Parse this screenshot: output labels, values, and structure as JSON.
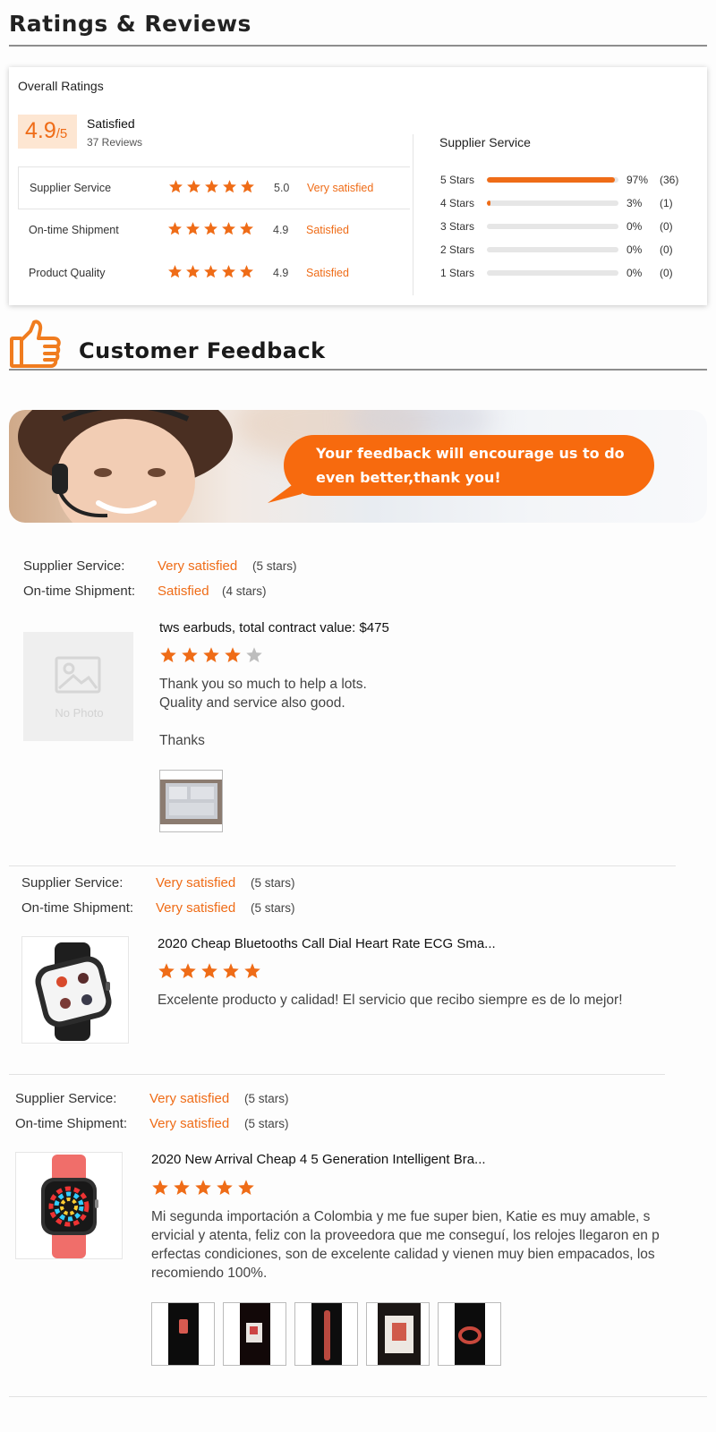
{
  "header": {
    "title": "Ratings & Reviews"
  },
  "overall": {
    "title": "Overall Ratings",
    "score": "4.9",
    "score_den": "/5",
    "label": "Satisfied",
    "reviews": "37 Reviews",
    "metrics": [
      {
        "name": "Supplier Service",
        "value": "5.0",
        "rating": 5.0,
        "text": "Very satisfied"
      },
      {
        "name": "On-time Shipment",
        "value": "4.9",
        "rating": 4.9,
        "text": "Satisfied"
      },
      {
        "name": "Product Quality",
        "value": "4.9",
        "rating": 4.9,
        "text": "Satisfied"
      }
    ],
    "distribution_title": "Supplier Service",
    "distribution": [
      {
        "label": "5 Stars",
        "pct": "97%",
        "count": "(36)",
        "fraction": 0.97
      },
      {
        "label": "4 Stars",
        "pct": "3%",
        "count": "(1)",
        "fraction": 0.03
      },
      {
        "label": "3 Stars",
        "pct": "0%",
        "count": "(0)",
        "fraction": 0
      },
      {
        "label": "2 Stars",
        "pct": "0%",
        "count": "(0)",
        "fraction": 0
      },
      {
        "label": "1 Stars",
        "pct": "0%",
        "count": "(0)",
        "fraction": 0
      }
    ]
  },
  "feedback": {
    "title": "Customer Feedback",
    "banner_line1": "Your feedback will encourage us to do",
    "banner_line2": "even better,thank you!",
    "reviews": [
      {
        "supplier_label": "Supplier Service:",
        "supplier_value": "Very satisfied",
        "supplier_stars": "(5 stars)",
        "shipment_label": "On-time Shipment:",
        "shipment_value": "Satisfied",
        "shipment_stars": "(4 stars)",
        "photo": "no-photo",
        "photo_text": "No Photo",
        "title": "tws earbuds, total contract value: $475",
        "rating": 4,
        "body_lines": [
          "Thank you so much to help a lots.",
          "Quality and service also good.",
          "",
          "Thanks"
        ],
        "attachments": 1
      },
      {
        "supplier_label": "Supplier Service:",
        "supplier_value": "Very satisfied",
        "supplier_stars": "(5 stars)",
        "shipment_label": "On-time Shipment:",
        "shipment_value": "Very satisfied",
        "shipment_stars": "(5 stars)",
        "photo": "black-smartwatch",
        "title": "2020 Cheap Bluetooths Call Dial Heart Rate ECG Sma...",
        "rating": 5,
        "body_lines": [
          "Excelente producto y calidad! El servicio que recibo siempre es de lo mejor!"
        ],
        "attachments": 0
      },
      {
        "supplier_label": "Supplier Service:",
        "supplier_value": "Very satisfied",
        "supplier_stars": "(5 stars)",
        "shipment_label": "On-time Shipment:",
        "shipment_value": "Very satisfied",
        "shipment_stars": "(5 stars)",
        "photo": "pink-smartwatch",
        "title": "2020 New Arrival Cheap 4 5 Generation Intelligent Bra...",
        "rating": 5,
        "body_lines": [
          "Mi segunda importación a Colombia y me fue super bien, Katie es muy amable, s",
          "ervicial y atenta, feliz con la proveedora que me conseguí, los relojes llegaron en p",
          "erfectas condiciones, son de excelente calidad y vienen muy bien empacados, los",
          "recomiendo 100%."
        ],
        "attachments": 5
      }
    ]
  },
  "colors": {
    "accent": "#ef6c17",
    "star_empty": "#bdbdbd",
    "bar_track": "#e6e6e6"
  }
}
